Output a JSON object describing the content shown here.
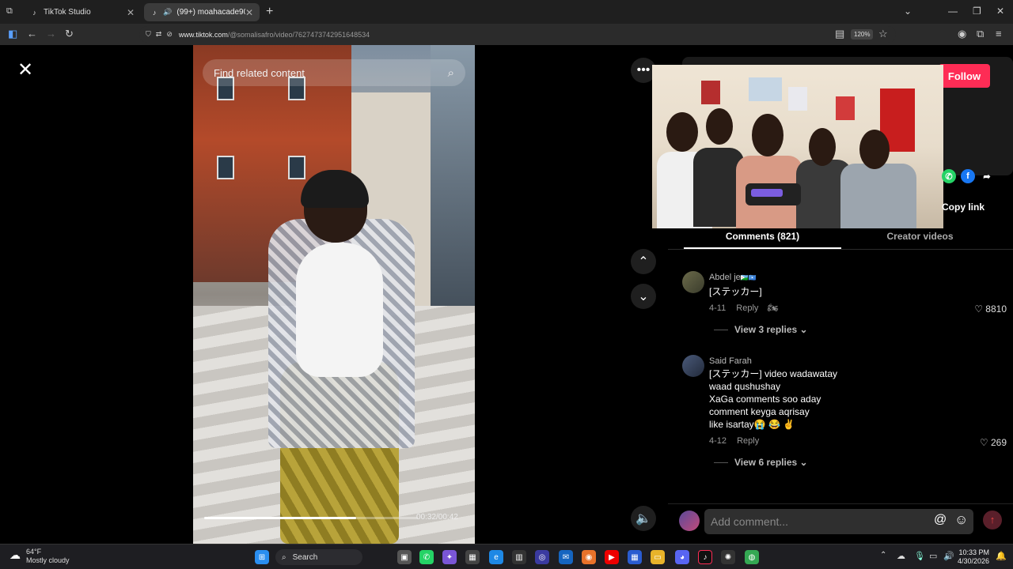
{
  "browser": {
    "tabs": [
      {
        "title": "TikTok Studio",
        "active": false
      },
      {
        "title": "(99+) moahacade90 (@moha",
        "active": true
      }
    ],
    "url_host": "www.tiktok.com",
    "url_path": "/@somalisafro/video/7627473742951648534",
    "zoom": "120%"
  },
  "video": {
    "search_placeholder": "Find related content",
    "progress": 0.71,
    "timecode": "00:32/00:42"
  },
  "right": {
    "follow_label": "Follow",
    "copy_link_label": "Copy link",
    "tabs": [
      {
        "label": "Comments (821)",
        "active": true
      },
      {
        "label": "Creator videos",
        "active": false
      }
    ]
  },
  "comments": [
    {
      "author": "Abdel je",
      "author_flags": "🇩🇯🇸🇴",
      "text": [
        "[ステッカー]"
      ],
      "date": "4-11",
      "reply_label": "Reply",
      "likes": "8810",
      "view_replies": "View 3 replies"
    },
    {
      "author": "Said Farah",
      "text": [
        "[ステッカー] video wadawatay",
        "waad qushushay",
        "XaGa comments soo aday",
        "comment keyga aqrisay",
        "like isartay😭 😂 ✌️"
      ],
      "date": "4-12",
      "reply_label": "Reply",
      "likes": "269",
      "view_replies": "View 6 replies"
    }
  ],
  "comment_input": {
    "placeholder": "Add comment..."
  },
  "taskbar": {
    "weather_temp": "64°F",
    "weather_desc": "Mostly cloudy",
    "search_label": "Search",
    "time": "10:33 PM",
    "date": "4/30/2026"
  },
  "colors": {
    "follow_button": "#fe2c55",
    "background": "#000000"
  }
}
